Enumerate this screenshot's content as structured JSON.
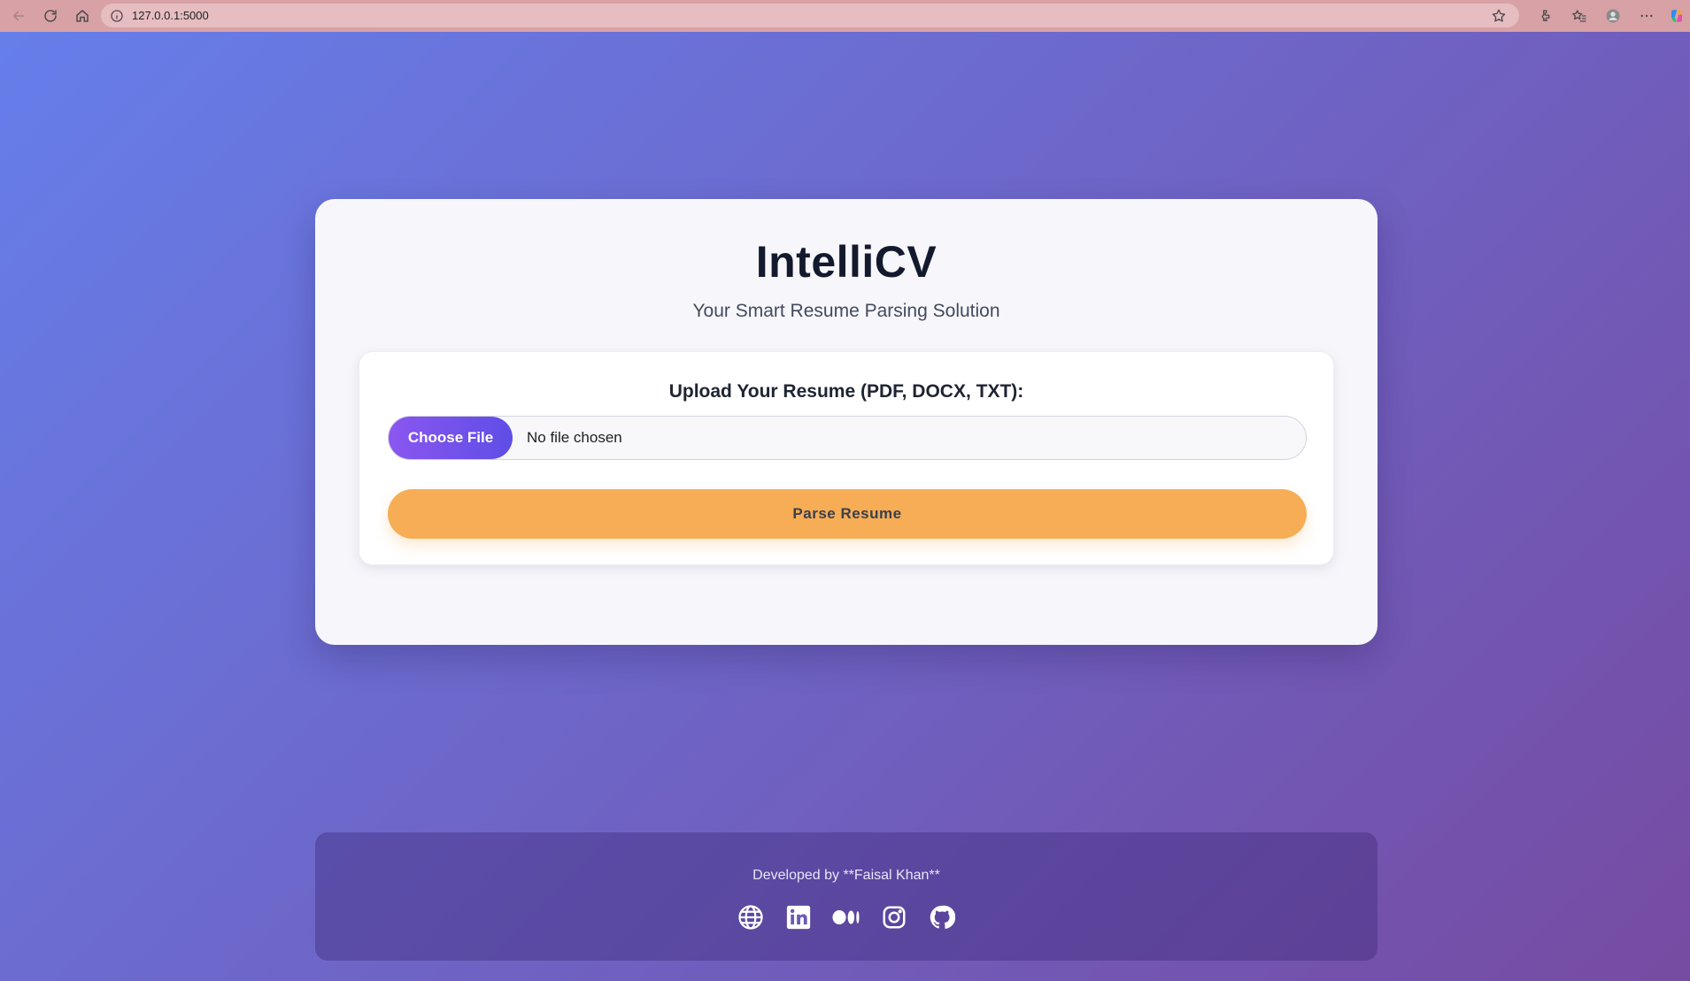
{
  "browser": {
    "url": "127.0.0.1:5000"
  },
  "app": {
    "title": "IntelliCV",
    "subtitle": "Your Smart Resume Parsing Solution"
  },
  "upload": {
    "label": "Upload Your Resume (PDF, DOCX, TXT):",
    "choose_button": "Choose File",
    "file_status": "No file chosen",
    "parse_button": "Parse Resume"
  },
  "footer": {
    "text": "Developed by **Faisal Khan**",
    "socials": [
      {
        "icon": "globe-icon"
      },
      {
        "icon": "linkedin-icon"
      },
      {
        "icon": "medium-icon"
      },
      {
        "icon": "instagram-icon"
      },
      {
        "icon": "github-icon"
      }
    ]
  },
  "colors": {
    "gradient_start": "#667eea",
    "gradient_end": "#764ba2",
    "parse_button": "#f6ad55",
    "choose_button_start": "#8b56f0",
    "choose_button_end": "#5e4ee6",
    "title": "#141a2e"
  }
}
